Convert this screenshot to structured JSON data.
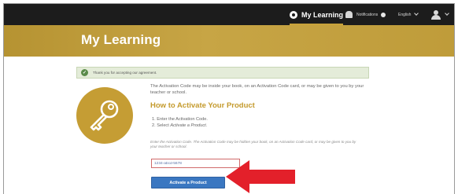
{
  "topnav": {
    "my_learning": "My Learning",
    "notifications": "Notifications",
    "language": "English"
  },
  "banner": {
    "title": "My Learning"
  },
  "alert": {
    "text": "Thank you for accepting our agreement."
  },
  "content": {
    "intro": "The Activation Code may be inside your book, on an Activation Code card, or may be given to you by your teacher or school.",
    "heading": "How to Activate Your Product",
    "steps": [
      {
        "number": "1.",
        "text": "Enter the Activation Code."
      },
      {
        "number": "2.",
        "text": "Select",
        "emphasis": "Activate a Product."
      }
    ],
    "help": "Enter the Activation Code. The Activation Code may be hidden your book, on an Activation Code card, or may be given to you by your teacher or school.",
    "input_value": "1234-abcd-5678",
    "button_label": "Activate a Product"
  },
  "colors": {
    "accent_gold": "#c59d34",
    "nav_bar": "#1c1c1c",
    "button_blue": "#3a77c1",
    "alert_green": "#e4ecd9",
    "annotation_red": "#e3202a"
  },
  "icons": {
    "key": "key-icon",
    "success": "check-circle-icon",
    "learning": "circle-icon",
    "notifications": "bell-icon",
    "user": "user-icon",
    "annotation": "red-arrow-icon"
  }
}
